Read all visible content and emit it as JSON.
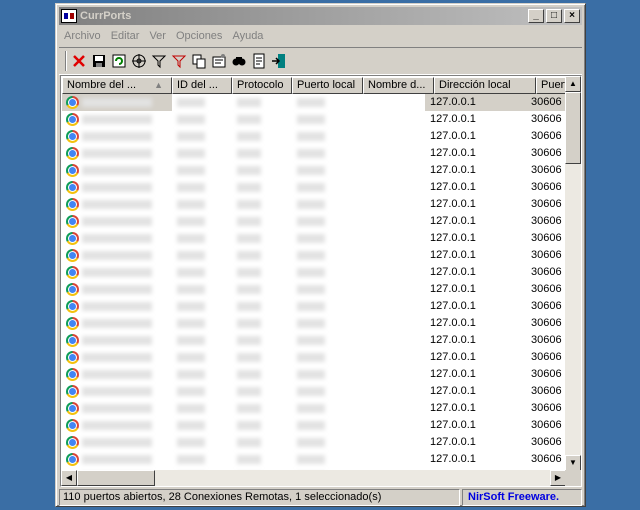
{
  "window": {
    "title": "CurrPorts"
  },
  "menu": [
    "Archivo",
    "Editar",
    "Ver",
    "Opciones",
    "Ayuda"
  ],
  "toolbar": {
    "icons": [
      "close-connection-icon",
      "save-icon",
      "refresh-icon",
      "target-icon",
      "filter-icon",
      "filter-red-icon",
      "copy-icon",
      "properties-icon",
      "find-icon",
      "report-icon",
      "exit-icon"
    ]
  },
  "columns": [
    "Nombre del ...",
    "ID del ...",
    "Protocolo",
    "Puerto local",
    "Nombre d...",
    "Dirección local",
    "Puerto"
  ],
  "rows": [
    {
      "local_address": "127.0.0.1",
      "local_port": "30606"
    },
    {
      "local_address": "127.0.0.1",
      "local_port": "30606"
    },
    {
      "local_address": "127.0.0.1",
      "local_port": "30606"
    },
    {
      "local_address": "127.0.0.1",
      "local_port": "30606"
    },
    {
      "local_address": "127.0.0.1",
      "local_port": "30606"
    },
    {
      "local_address": "127.0.0.1",
      "local_port": "30606"
    },
    {
      "local_address": "127.0.0.1",
      "local_port": "30606"
    },
    {
      "local_address": "127.0.0.1",
      "local_port": "30606"
    },
    {
      "local_address": "127.0.0.1",
      "local_port": "30606"
    },
    {
      "local_address": "127.0.0.1",
      "local_port": "30606"
    },
    {
      "local_address": "127.0.0.1",
      "local_port": "30606"
    },
    {
      "local_address": "127.0.0.1",
      "local_port": "30606"
    },
    {
      "local_address": "127.0.0.1",
      "local_port": "30606"
    },
    {
      "local_address": "127.0.0.1",
      "local_port": "30606"
    },
    {
      "local_address": "127.0.0.1",
      "local_port": "30606"
    },
    {
      "local_address": "127.0.0.1",
      "local_port": "30606"
    },
    {
      "local_address": "127.0.0.1",
      "local_port": "30606"
    },
    {
      "local_address": "127.0.0.1",
      "local_port": "30606"
    },
    {
      "local_address": "127.0.0.1",
      "local_port": "30606"
    },
    {
      "local_address": "127.0.0.1",
      "local_port": "30606"
    },
    {
      "local_address": "127.0.0.1",
      "local_port": "30606"
    },
    {
      "local_address": "127.0.0.1",
      "local_port": "30606"
    },
    {
      "local_address": "127.0.0.1",
      "local_port": "30606"
    }
  ],
  "statusbar": {
    "text": "110 puertos abiertos, 28 Conexiones Remotas, 1 seleccionado(s)",
    "link": "NirSoft Freeware."
  }
}
